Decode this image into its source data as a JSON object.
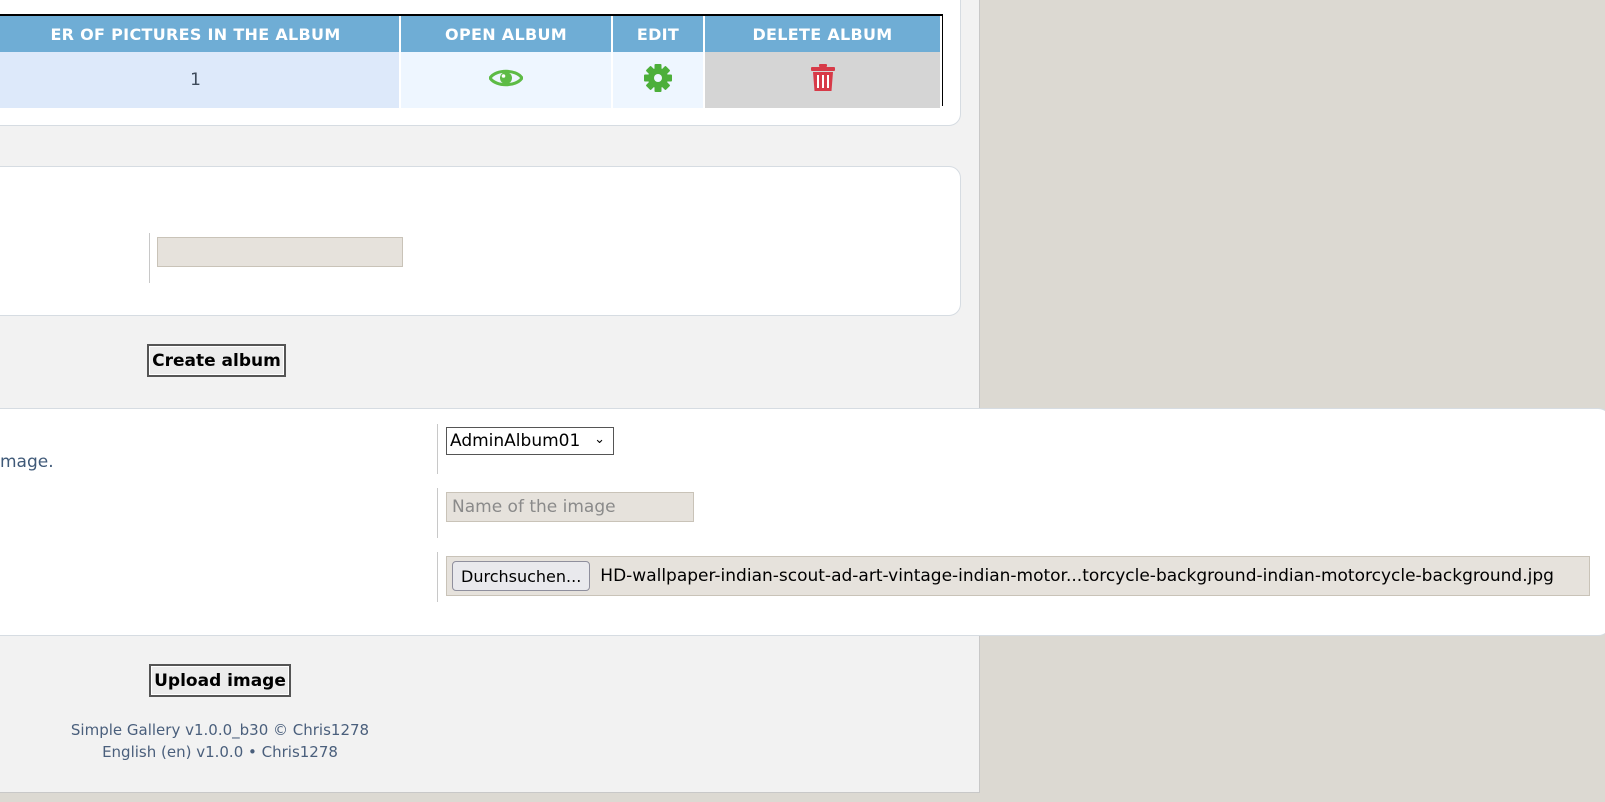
{
  "albums_table": {
    "headers": {
      "count": "ER OF PICTURES IN THE ALBUM",
      "open": "OPEN ALBUM",
      "edit": "EDIT",
      "delete": "DELETE ALBUM"
    },
    "rows": [
      {
        "count": "1",
        "open_icon": "eye-icon",
        "edit_icon": "gear-icon",
        "delete_icon": "trash-icon"
      }
    ]
  },
  "create_album": {
    "name_value": "",
    "button_label": "Create album"
  },
  "upload": {
    "hint_text": "mage.",
    "album_select_value": "AdminAlbum01",
    "image_name_placeholder": "Name of the image",
    "browse_label": "Durchsuchen...",
    "file_name": "HD-wallpaper-indian-scout-ad-art-vintage-indian-motor...torcycle-background-indian-motorcycle-background.jpg",
    "button_label": "Upload image"
  },
  "footer": {
    "line1": "Simple Gallery v1.0.0_b30 © Chris1278",
    "line2": "English (en) v1.0.0 • Chris1278"
  },
  "colors": {
    "header_blue": "#6fadd5",
    "eye_green": "#5dbb45",
    "gear_green": "#4caf3a",
    "trash_red": "#d73a48"
  }
}
